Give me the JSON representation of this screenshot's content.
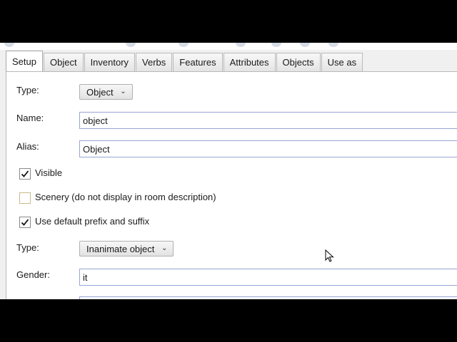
{
  "tabs": [
    {
      "label": "Setup",
      "active": true
    },
    {
      "label": "Object",
      "active": false
    },
    {
      "label": "Inventory",
      "active": false
    },
    {
      "label": "Verbs",
      "active": false
    },
    {
      "label": "Features",
      "active": false
    },
    {
      "label": "Attributes",
      "active": false
    },
    {
      "label": "Objects",
      "active": false
    },
    {
      "label": "Use as",
      "active": false
    }
  ],
  "setup": {
    "type_label": "Type:",
    "type_value": "Object",
    "name_label": "Name:",
    "name_value": "object",
    "alias_label": "Alias:",
    "alias_value": "Object",
    "visible_label": "Visible",
    "visible_checked": true,
    "scenery_label": "Scenery (do not display in room description)",
    "scenery_checked": false,
    "prefix_label": "Use default prefix and suffix",
    "prefix_checked": true,
    "type2_label": "Type:",
    "type2_value": "Inanimate object",
    "gender_label": "Gender:",
    "gender_value": "it"
  },
  "icons": {
    "combo_arrow": "chevron-down-icon",
    "check": "checkmark-icon",
    "cursor": "mouse-pointer-icon"
  }
}
